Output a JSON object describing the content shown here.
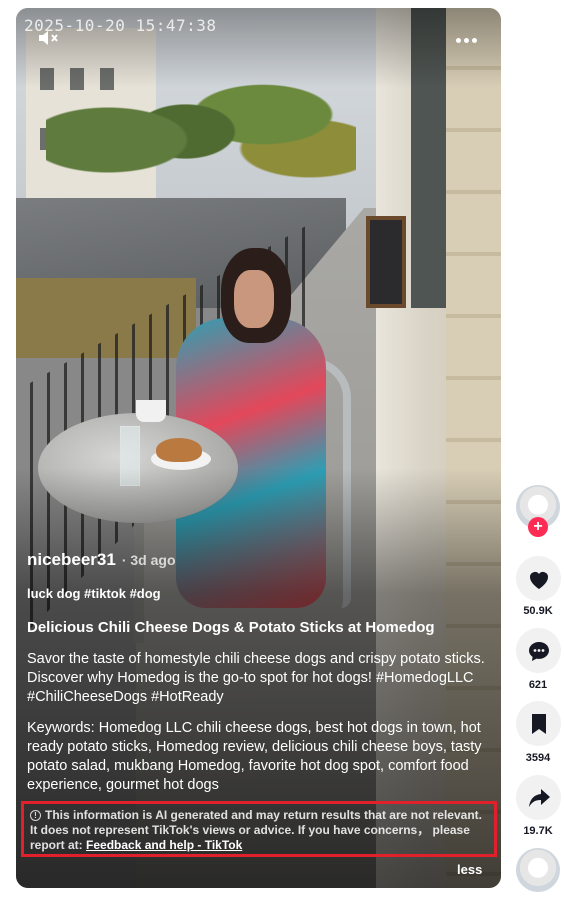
{
  "video": {
    "timestamp": "2025-10-20 15:47:38",
    "mute_icon": "speaker-muted-icon",
    "more_icon": "ellipsis-icon"
  },
  "caption": {
    "author": "nicebeer31",
    "post_age": "· 3d ago",
    "tags": "luck dog #tiktok #dog",
    "title": "Delicious Chili Cheese Dogs & Potato Sticks at Homedog",
    "description": "Savor the taste of homestyle chili cheese dogs and crispy potato sticks. Discover why Homedog is the go-to spot for hot dogs! #HomedogLLC #ChiliCheeseDogs #HotReady",
    "keywords": "Keywords: Homedog LLC chili cheese dogs, best hot dogs in town, hot ready potato sticks, Homedog review, delicious chili cheese boys, tasty potato salad, mukbang Homedog, favorite hot dog spot, comfort food experience, gourmet hot dogs"
  },
  "ai_notice": {
    "icon": "info-icon",
    "text": "This information is AI generated and may return results that are not relevant. It does not represent TikTok's views or advice. If you have concerns， please report at: ",
    "link_label": "Feedback and help - TikTok",
    "accent_color": "#e0202b"
  },
  "less_label": "less",
  "side_rail": {
    "follow_symbol": "+",
    "follow_color": "#fe2c55",
    "likes": "50.9K",
    "comments": "621",
    "saves": "3594",
    "shares": "19.7K"
  }
}
